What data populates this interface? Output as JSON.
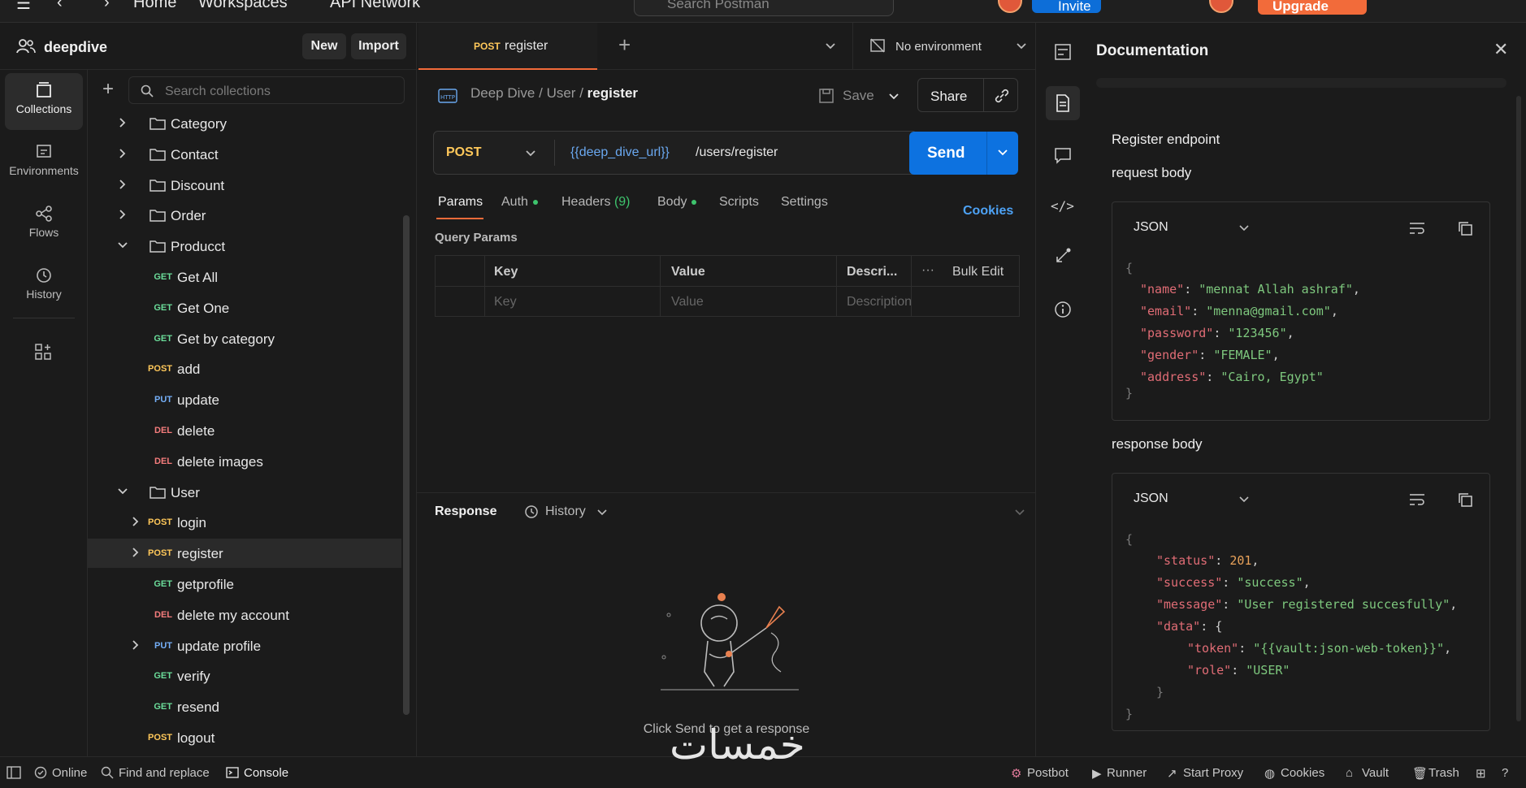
{
  "topbar": {
    "home": "Home",
    "workspaces": "Workspaces",
    "api_network": "API Network",
    "search_placeholder": "Search Postman",
    "invite": "Invite",
    "upgrade": "Upgrade"
  },
  "workspace": {
    "name": "deepdive",
    "new_label": "New",
    "import_label": "Import"
  },
  "rail": [
    {
      "label": "Collections",
      "icon": "collections-icon",
      "active": true
    },
    {
      "label": "Environments",
      "icon": "environments-icon"
    },
    {
      "label": "Flows",
      "icon": "flows-icon"
    },
    {
      "label": "History",
      "icon": "history-icon"
    }
  ],
  "tree": {
    "search_placeholder": "Search collections",
    "items": [
      {
        "type": "folder",
        "label": "Category",
        "expanded": false
      },
      {
        "type": "folder",
        "label": "Contact",
        "expanded": false
      },
      {
        "type": "folder",
        "label": "Discount",
        "expanded": false
      },
      {
        "type": "folder",
        "label": "Order",
        "expanded": false
      },
      {
        "type": "folder",
        "label": "Producct",
        "expanded": true
      },
      {
        "type": "request",
        "method": "GET",
        "label": "Get All"
      },
      {
        "type": "request",
        "method": "GET",
        "label": "Get One"
      },
      {
        "type": "request",
        "method": "GET",
        "label": "Get by category"
      },
      {
        "type": "request",
        "method": "POST",
        "label": "add"
      },
      {
        "type": "request",
        "method": "PUT",
        "label": "update"
      },
      {
        "type": "request",
        "method": "DEL",
        "label": "delete"
      },
      {
        "type": "request",
        "method": "DEL",
        "label": "delete images"
      },
      {
        "type": "folder",
        "label": "User",
        "expanded": true
      },
      {
        "type": "request",
        "method": "POST",
        "label": "login",
        "chevron": true
      },
      {
        "type": "request",
        "method": "POST",
        "label": "register",
        "chevron": true,
        "selected": true
      },
      {
        "type": "request",
        "method": "GET",
        "label": "getprofile"
      },
      {
        "type": "request",
        "method": "DEL",
        "label": "delete my account"
      },
      {
        "type": "request",
        "method": "PUT",
        "label": "update profile",
        "chevron": true
      },
      {
        "type": "request",
        "method": "GET",
        "label": "verify"
      },
      {
        "type": "request",
        "method": "GET",
        "label": "resend"
      },
      {
        "type": "request",
        "method": "POST",
        "label": "logout",
        "root": true
      }
    ]
  },
  "tab": {
    "method": "POST",
    "label": "register"
  },
  "environment": "No environment",
  "breadcrumb": {
    "c1": "Deep Dive",
    "c2": "User",
    "current": "register"
  },
  "save_label": "Save",
  "share_label": "Share",
  "request": {
    "method": "POST",
    "url_var": "{{deep_dive_url}}",
    "url_path": "/users/register",
    "send_label": "Send"
  },
  "req_tabs": {
    "params": "Params",
    "auth": "Auth",
    "headers": "Headers",
    "headers_count": "(9)",
    "body": "Body",
    "scripts": "Scripts",
    "settings": "Settings",
    "cookies": "Cookies"
  },
  "params": {
    "title": "Query Params",
    "col_key": "Key",
    "col_value": "Value",
    "col_desc": "Descri...",
    "bulk_edit": "Bulk Edit",
    "ph_key": "Key",
    "ph_value": "Value",
    "ph_desc": "Description"
  },
  "response": {
    "title": "Response",
    "history": "History",
    "empty_text": "Click Send to get a response"
  },
  "doc": {
    "title": "Documentation",
    "intro": "Register endpoint",
    "request_heading": "request body",
    "response_heading": "response body",
    "format": "JSON",
    "request_body": [
      {
        "k": "name",
        "v": "mennat Allah ashraf"
      },
      {
        "k": "email",
        "v": "menna@gmail.com"
      },
      {
        "k": "password",
        "v": "123456"
      },
      {
        "k": "gender",
        "v": "FEMALE"
      },
      {
        "k": "address",
        "v": "Cairo, Egypt"
      }
    ],
    "response_body": {
      "status": "201",
      "success": "success",
      "message": "User registered succesfully",
      "token": "{{vault:json-web-token}}",
      "role": "USER"
    }
  },
  "statusbar": {
    "online": "Online",
    "find_replace": "Find and replace",
    "console": "Console",
    "postbot": "Postbot",
    "runner": "Runner",
    "start_proxy": "Start Proxy",
    "cookies": "Cookies",
    "vault": "Vault",
    "trash": "Trash"
  },
  "watermark": "خمسات",
  "colors": {
    "accent": "#f26b3a",
    "send": "#0d72e0",
    "get": "#6bdd9a",
    "post": "#ffc85a",
    "put": "#74aef6",
    "del": "#f47c7c"
  }
}
